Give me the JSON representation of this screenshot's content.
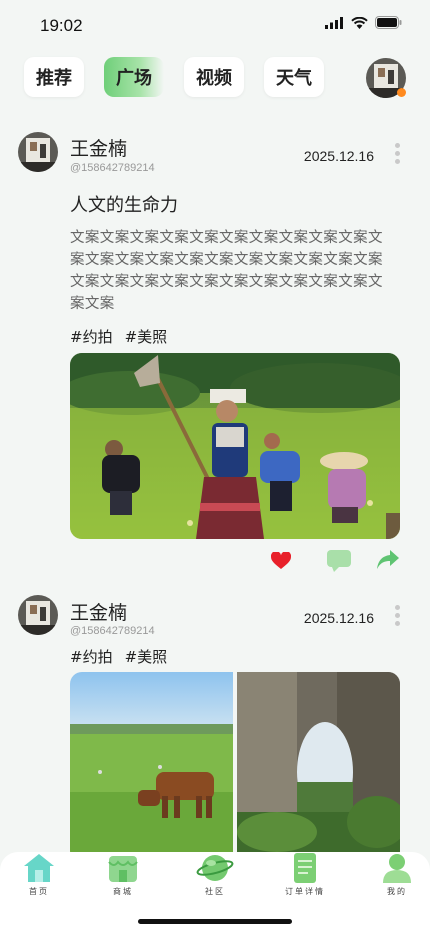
{
  "status_bar": {
    "time": "19:02"
  },
  "tabs": [
    {
      "label": "推荐",
      "active": false
    },
    {
      "label": "广场",
      "active": true
    },
    {
      "label": "视频",
      "active": false
    },
    {
      "label": "天气",
      "active": false
    }
  ],
  "posts": [
    {
      "username": "王金楠",
      "user_id": "@158642789214",
      "date": "2025.12.16",
      "title": "人文的生命力",
      "body": "文案文案文案文案文案文案文案文案文案文案文案文案文案文案文案文案文案文案文案文案文案文案文案文案文案文案文案文案文案文案文案文案文案",
      "tags": [
        "#约拍",
        "#美照"
      ],
      "images": [
        "farmers-in-traditional-costume-field"
      ]
    },
    {
      "username": "王金楠",
      "user_id": "@158642789214",
      "date": "2025.12.16",
      "tags": [
        "#约拍",
        "#美照"
      ],
      "images": [
        "cow-grazing-on-meadow",
        "limestone-natural-arch"
      ]
    }
  ],
  "actions": {
    "like_icon": "heart-icon",
    "comment_icon": "comment-icon",
    "share_icon": "share-icon",
    "like_color": "#e8202a",
    "accent": "#6fcf79"
  },
  "bottom_nav": [
    {
      "label": "首页",
      "icon": "home-icon"
    },
    {
      "label": "商城",
      "icon": "store-icon"
    },
    {
      "label": "社区",
      "icon": "planet-icon"
    },
    {
      "label": "订单详情",
      "icon": "order-icon"
    },
    {
      "label": "我的",
      "icon": "user-icon"
    }
  ]
}
